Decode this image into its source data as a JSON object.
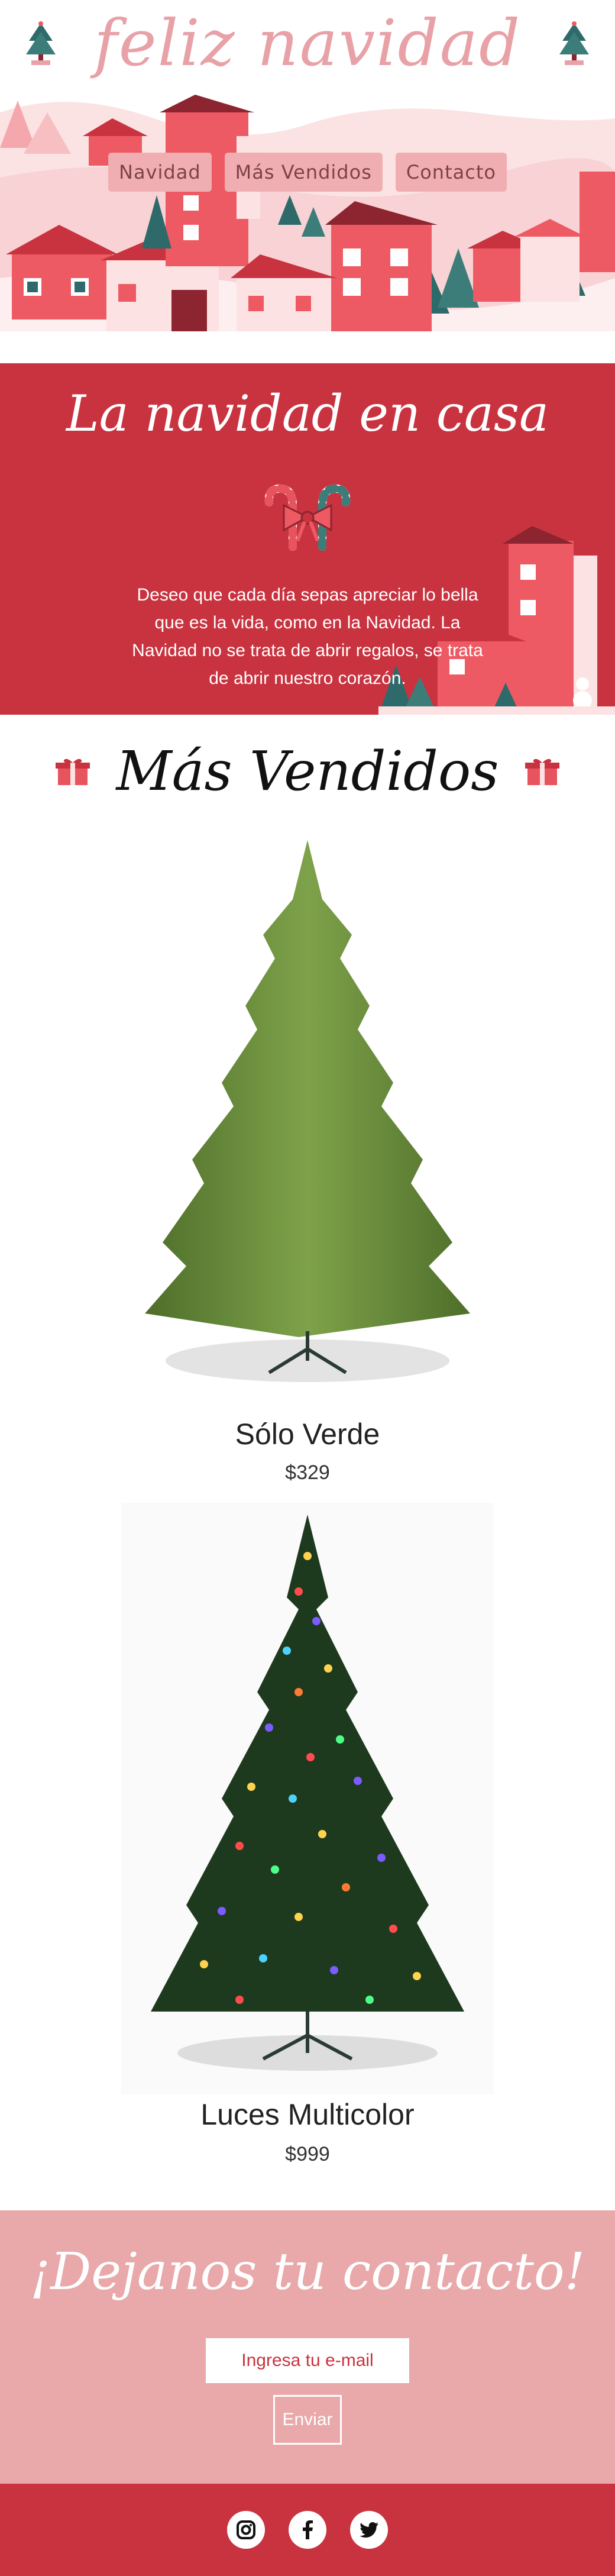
{
  "header": {
    "brand_title": "feliz navidad",
    "nav": [
      {
        "label": "Navidad"
      },
      {
        "label": "Más Vendidos"
      },
      {
        "label": "Contacto"
      }
    ]
  },
  "intro": {
    "title": "La navidad en casa",
    "text": "Deseo que cada día sepas apreciar lo bella que es la vida, como en la Navidad. La Navidad no se trata de abrir regalos, se trata de abrir nuestro corazón."
  },
  "products_section": {
    "title": "Más Vendidos",
    "items": [
      {
        "name": "Sólo Verde",
        "price": "$329"
      },
      {
        "name": "Luces Multicolor",
        "price": "$999"
      }
    ]
  },
  "contact": {
    "title": "¡Dejanos tu contacto!",
    "email_placeholder": "Ingresa tu e-mail",
    "submit_label": "Enviar"
  },
  "footer": {
    "social_icons": [
      "instagram-icon",
      "facebook-icon",
      "twitter-icon"
    ]
  },
  "colors": {
    "accent_red": "#c8333f",
    "soft_pink": "#e9a8aa",
    "nav_pink": "#f1aeb2"
  }
}
